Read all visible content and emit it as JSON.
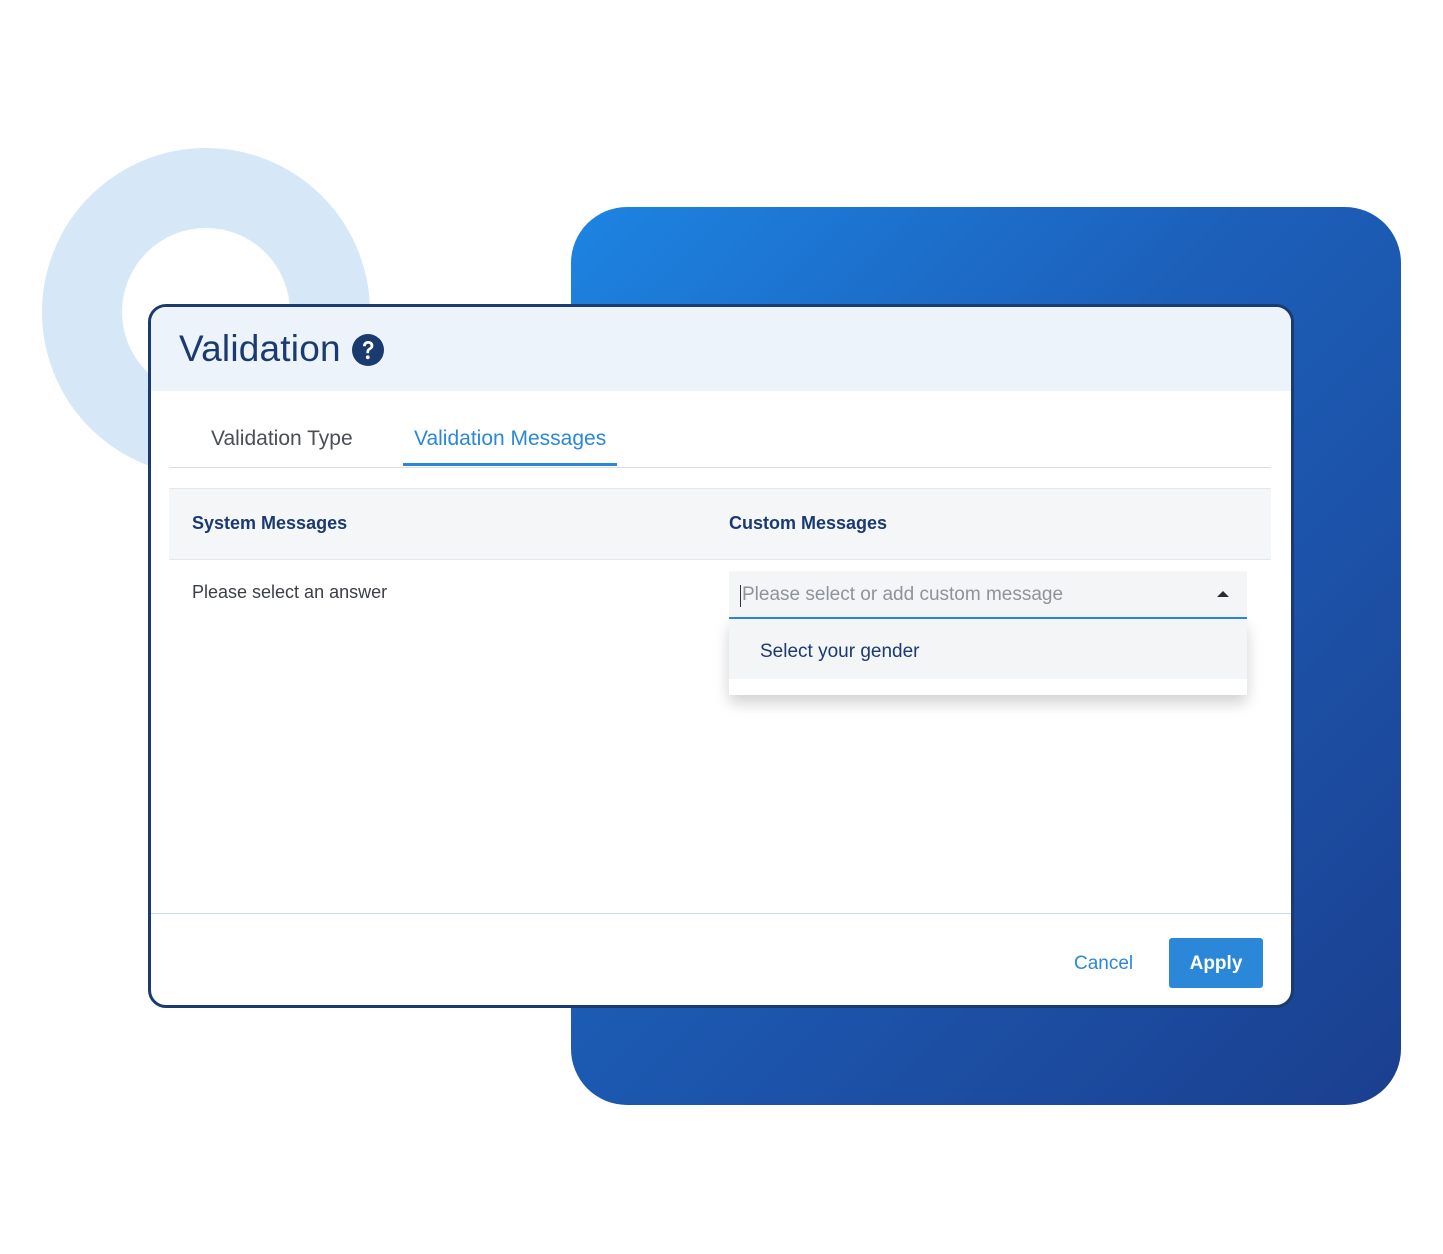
{
  "dialog": {
    "title": "Validation",
    "help_icon": "question-circle-icon"
  },
  "tabs": [
    {
      "label": "Validation Type",
      "active": false
    },
    {
      "label": "Validation Messages",
      "active": true
    }
  ],
  "table": {
    "headers": {
      "system": "System Messages",
      "custom": "Custom Messages"
    },
    "rows": [
      {
        "system_message": "Please select an answer",
        "custom_message_value": "",
        "custom_message_placeholder": "Please select or add custom message"
      }
    ]
  },
  "dropdown": {
    "expanded": true,
    "options": [
      "Select your gender"
    ]
  },
  "footer": {
    "cancel_label": "Cancel",
    "apply_label": "Apply"
  },
  "colors": {
    "accent": "#2b87d8",
    "title": "#1b3a6f",
    "header_bg": "#edf3fb",
    "deco_ring": "#d6e8f8",
    "deco_panel_start": "#1d84e2",
    "deco_panel_end": "#1b3f8f"
  }
}
